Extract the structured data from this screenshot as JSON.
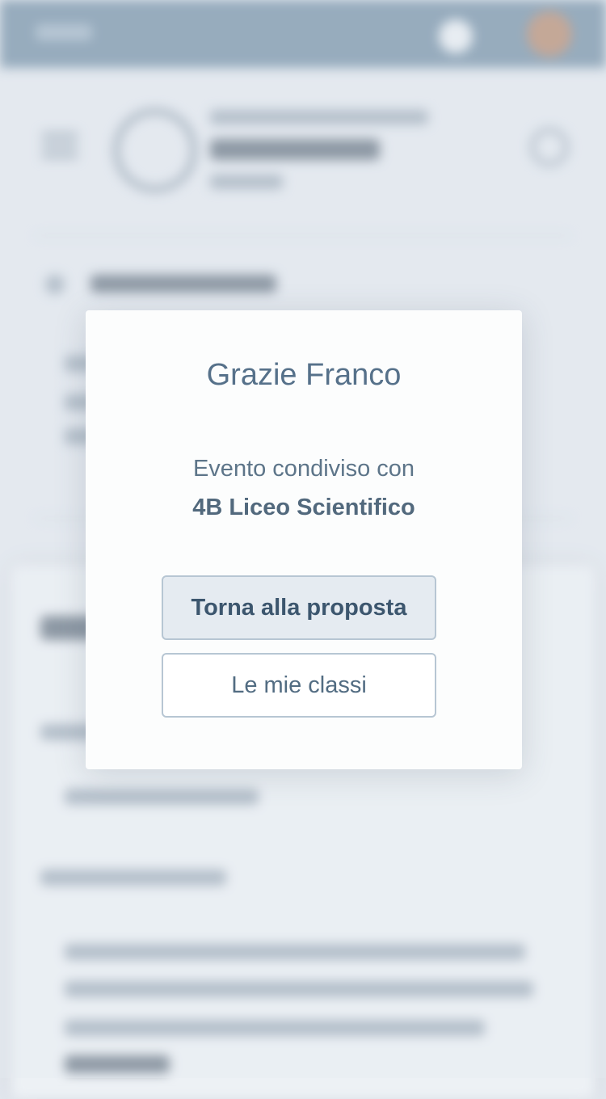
{
  "modal": {
    "title": "Grazie Franco",
    "message": "Evento condiviso con",
    "class_name": "4B Liceo Scientifico",
    "primary_button": "Torna alla proposta",
    "secondary_button": "Le mie classi"
  },
  "colors": {
    "header": "#6d8aa2",
    "background": "#e3e8ef",
    "modal_background": "#fcfdfd",
    "title_text": "#56718a",
    "primary_button_bg": "#e5ebf1",
    "button_border": "#b7c6d3"
  },
  "icons": {
    "header_bell": "bell-icon",
    "header_avatar": "avatar",
    "menu": "hamburger-menu-icon",
    "search": "search-icon"
  }
}
